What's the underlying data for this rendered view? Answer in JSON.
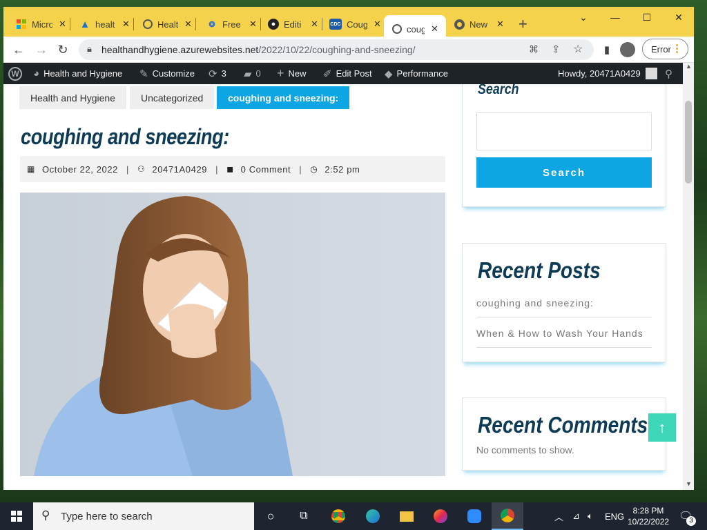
{
  "browser": {
    "tabs": [
      {
        "title": "Micro",
        "icon": "microsoft-icon"
      },
      {
        "title": "healt",
        "icon": "azure-icon"
      },
      {
        "title": "Healt",
        "icon": "globe-icon"
      },
      {
        "title": "Free",
        "icon": "free-icon"
      },
      {
        "title": "Editi",
        "icon": "github-icon"
      },
      {
        "title": "Coug",
        "icon": "cdc-icon"
      },
      {
        "title": "coug",
        "icon": "globe-icon",
        "active": true
      },
      {
        "title": "New",
        "icon": "chrome-icon"
      }
    ],
    "url_host": "healthandhygiene.azurewebsites.net",
    "url_path": "/2022/10/22/coughing-and-sneezing/",
    "error_label": "Error"
  },
  "adminbar": {
    "site_name": "Health and Hygiene",
    "customize": "Customize",
    "updates_count": "3",
    "comments_count": "0",
    "new_label": "New",
    "edit_post": "Edit Post",
    "performance": "Performance",
    "howdy": "Howdy, 20471A0429"
  },
  "post": {
    "categories": [
      "Health and Hygiene",
      "Uncategorized",
      "coughing and sneezing:"
    ],
    "title": "coughing and sneezing:",
    "date": "October 22, 2022",
    "author": "20471A0429",
    "comments": "0 Comment",
    "time": "2:52 pm"
  },
  "sidebar": {
    "search_title": "Search",
    "search_button": "Search",
    "recent_posts_title": "Recent Posts",
    "recent_posts": [
      "coughing and sneezing:",
      "When & How to Wash Your Hands"
    ],
    "recent_comments_title": "Recent Comments",
    "no_comments": "No comments to show."
  },
  "taskbar": {
    "search_placeholder": "Type here to search",
    "language": "ENG",
    "time": "8:28 PM",
    "date": "10/22/2022",
    "notifications": "3"
  },
  "colors": {
    "accent": "#0ea5e4",
    "title": "#0d3b55",
    "tabstrip": "#f5d24b",
    "totop": "#3dd6b8"
  }
}
